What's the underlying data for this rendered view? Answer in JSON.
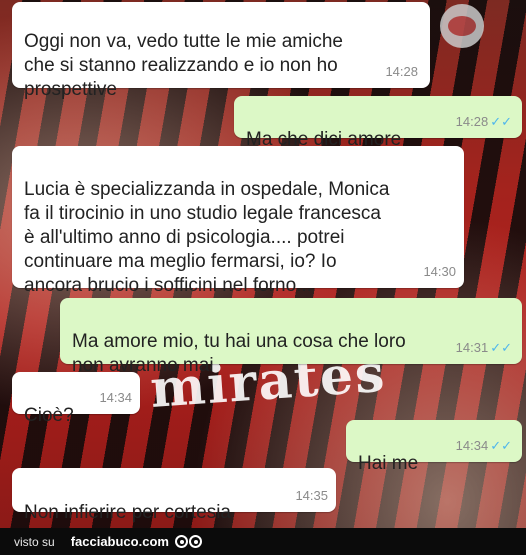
{
  "messages": [
    {
      "id": "m1",
      "direction": "in",
      "text": "Oggi non va, vedo tutte le mie amiche\nche si stanno realizzando e io non ho\nprospettive",
      "time": "14:28"
    },
    {
      "id": "m2",
      "direction": "out",
      "text": "Ma che dici amore",
      "time": "14:28"
    },
    {
      "id": "m3",
      "direction": "in",
      "text": "Lucia è specializzanda in ospedale, Monica\nfa il tirocinio in uno studio legale francesca\nè all'ultimo anno di psicologia.... potrei\ncontinuare ma meglio fermarsi, io? Io\nancora brucio i sofficini nel forno...",
      "time": "14:30"
    },
    {
      "id": "m4",
      "direction": "out",
      "text": "Ma amore mio, tu hai una cosa che loro\nnon avranno mai",
      "time": "14:31"
    },
    {
      "id": "m5",
      "direction": "in",
      "text": "Cioè?",
      "time": "14:34"
    },
    {
      "id": "m6",
      "direction": "out",
      "text": "Hai me",
      "time": "14:34"
    },
    {
      "id": "m7",
      "direction": "in",
      "text": "Non infierire per cortesia",
      "time": "14:35"
    }
  ],
  "read_tick": "✓✓",
  "background_text": "mirates",
  "footer": {
    "label": "visto su",
    "site": "facciabuco.com"
  }
}
